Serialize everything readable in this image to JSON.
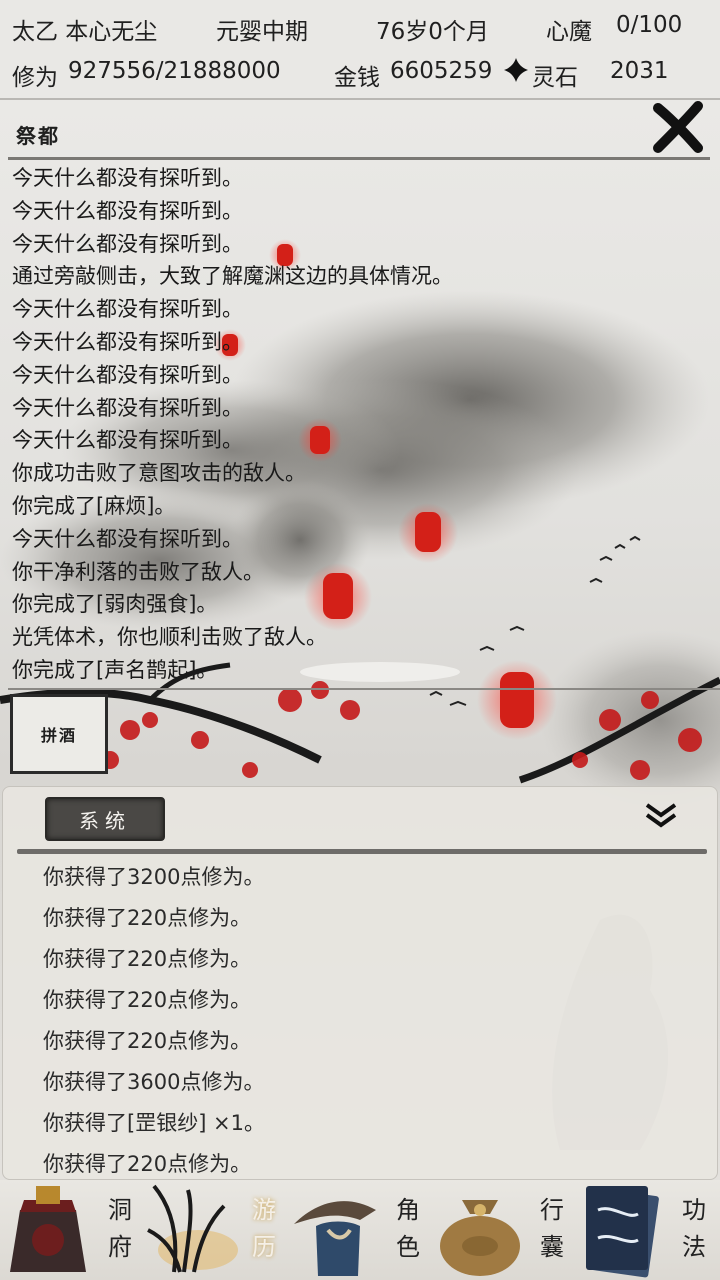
{
  "status": {
    "name": "太乙 本心无尘",
    "realm": "元婴中期",
    "age": "76岁0个月",
    "heart_demon_label": "心魔",
    "heart_demon_value": "0/100",
    "cultivation_label": "修为",
    "cultivation_value": "927556/21888000",
    "money_label": "金钱",
    "money_value": "6605259",
    "spirit_stone_label": "灵石",
    "spirit_stone_value": "2031"
  },
  "location": {
    "title": "祭都"
  },
  "log": [
    "今天什么都没有探听到。",
    "今天什么都没有探听到。",
    "今天什么都没有探听到。",
    "通过旁敲侧击，大致了解魔渊这边的具体情况。",
    "今天什么都没有探听到。",
    "今天什么都没有探听到。",
    "今天什么都没有探听到。",
    "今天什么都没有探听到。",
    "今天什么都没有探听到。",
    "你成功击败了意图攻击的敌人。",
    "你完成了[麻烦]。",
    "今天什么都没有探听到。",
    "你干净利落的击败了敌人。",
    "你完成了[弱肉强食]。",
    "光凭体术，你也顺利击败了敌人。",
    "你完成了[声名鹊起]。"
  ],
  "action": {
    "label": "拼酒"
  },
  "system": {
    "tab_label": "系统",
    "messages": [
      "你获得了3200点修为。",
      "你获得了220点修为。",
      "你获得了220点修为。",
      "你获得了220点修为。",
      "你获得了220点修为。",
      "你获得了3600点修为。",
      "你获得了[罡银纱] ×1。",
      "你获得了220点修为。"
    ]
  },
  "nav": [
    {
      "label": "洞府",
      "icon": "cave-bag-icon"
    },
    {
      "label": "游历",
      "icon": "travel-reed-icon",
      "active": true
    },
    {
      "label": "角色",
      "icon": "character-hat-icon"
    },
    {
      "label": "行囊",
      "icon": "pouch-icon"
    },
    {
      "label": "功法",
      "icon": "book-icon"
    }
  ]
}
